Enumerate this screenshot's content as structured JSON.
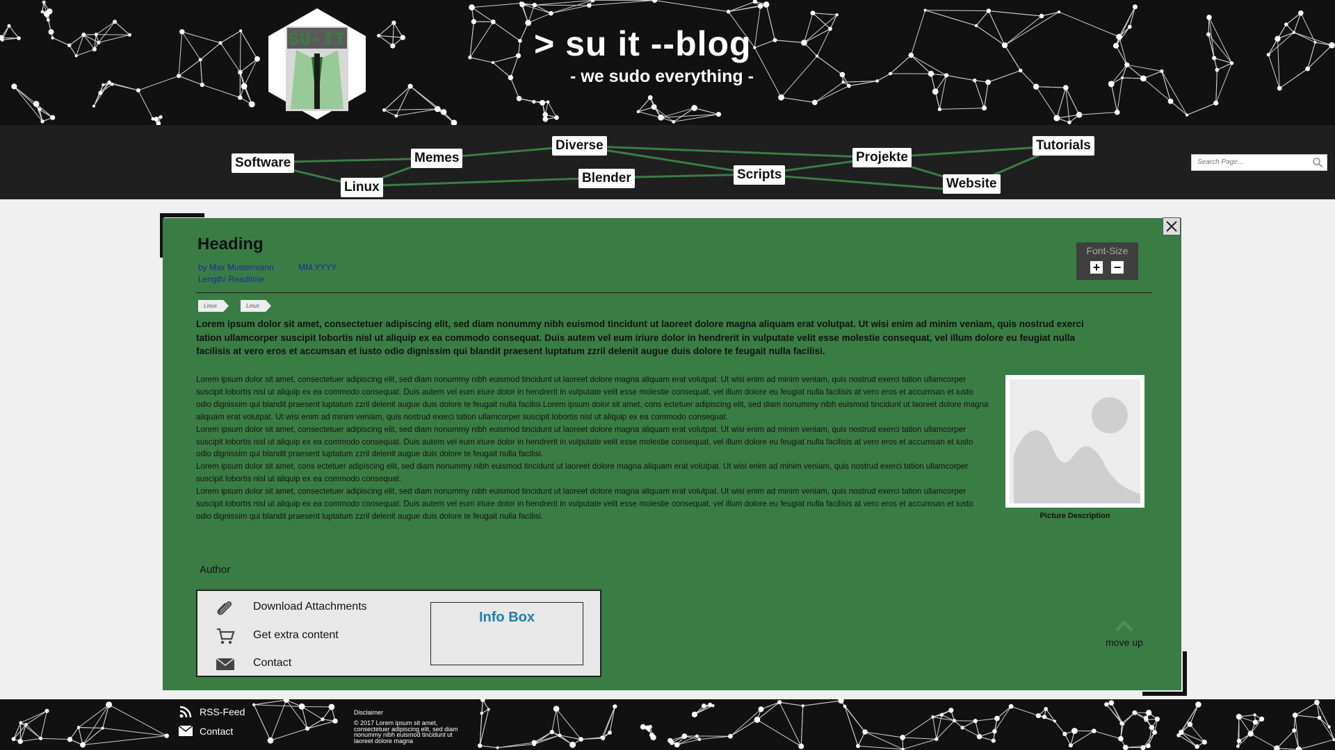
{
  "header": {
    "title": "> su it --blog",
    "subtitle": "- we sudo everything -",
    "logo_text": "SU-IT"
  },
  "nav": {
    "items": [
      {
        "label": "Software"
      },
      {
        "label": "Linux"
      },
      {
        "label": "Memes"
      },
      {
        "label": "Diverse"
      },
      {
        "label": "Blender"
      },
      {
        "label": "Scripts"
      },
      {
        "label": "Projekte"
      },
      {
        "label": "Website"
      },
      {
        "label": "Tutorials"
      }
    ],
    "search_placeholder": "Search Page..."
  },
  "article": {
    "heading": "Heading",
    "author": "by Max Mustermann",
    "date": "MM.YYYY",
    "length": "Length/ Readtime",
    "font_size_label": "Font-Size",
    "font_plus": "+",
    "font_minus": "−",
    "tags": [
      "Linux",
      "Linux"
    ],
    "lead": "Lorem ipsum dolor sit amet, consectetuer adipiscing elit, sed diam nonummy nibh euismod tincidunt ut laoreet dolore magna aliquam erat volutpat. Ut wisi enim ad minim veniam, quis nostrud exerci tation ullamcorper suscipit lobortis nisl ut aliquip ex ea commodo consequat. Duis autem vel eum iriure dolor in hendrerit in vulputate velit esse molestie consequat, vel illum dolore eu feugiat nulla facilisis at vero eros et accumsan et iusto odio dignissim qui blandit praesent luptatum zzril delenit augue duis dolore te feugait nulla facilisi.",
    "paragraphs": [
      "Lorem ipsum dolor sit amet, consectetuer adipiscing elit, sed diam nonummy nibh euismod tincidunt ut laoreet dolore magna aliquam erat volutpat. Ut wisi enim ad minim veniam, quis nostrud exerci tation ullamcorper suscipit lobortis nisl ut aliquip ex ea commodo consequat. Duis autem vel eum iriure dolor in hendrerit in vulputate velit esse molestie consequat, vel illum dolore eu feugiat nulla facilisis at vero eros et accumsan et iusto odio dignissim qui blandit praesent luptatum zzril delenit augue duis dolore te feugait nulla facilisi.Lorem ipsum dolor sit amet, cons ectetuer adipiscing elit, sed diam nonummy nibh euismod tincidunt ut laoreet dolore magna aliquam erat volutpat. Ut wisi enim ad minim veniam, quis nostrud exerci tation ullamcorper suscipit lobortis nisl ut aliquip ex ea commodo consequat.",
      "Lorem ipsum dolor sit amet, consectetuer adipiscing elit, sed diam nonummy nibh euismod tincidunt ut laoreet dolore magna aliquam erat volutpat. Ut wisi enim ad minim veniam, quis nostrud exerci tation ullamcorper suscipit lobortis nisl ut aliquip ex ea commodo consequat. Duis autem vel eum iriure dolor in hendrerit in vulputate velit esse molestie consequat, vel illum dolore eu feugiat nulla facilisis at vero eros et accumsan et iusto odio dignissim qui blandit praesent luptatum zzril delenit augue duis dolore te feugait nulla facilisi.",
      "Lorem ipsum dolor sit amet, cons ectetuer adipiscing elit, sed diam nonummy nibh euismod tincidunt ut laoreet dolore magna aliquam erat volutpat. Ut wisi enim ad minim veniam, quis nostrud exerci tation ullamcorper suscipit lobortis nisl ut aliquip ex ea commodo consequat.",
      "Lorem ipsum dolor sit amet, consectetuer adipiscing elit, sed diam nonummy nibh euismod tincidunt ut laoreet dolore magna aliquam erat volutpat. Ut wisi enim ad minim veniam, quis nostrud exerci tation ullamcorper suscipit lobortis nisl ut aliquip ex ea commodo consequat. Duis autem vel eum iriure dolor in hendrerit in vulputate velit esse molestie consequat, vel illum dolore eu feugiat nulla facilisis at vero eros et accumsan et iusto odio dignissim qui blandit praesent luptatum zzril delenit augue duis dolore te feugait nulla facilisi."
    ],
    "picture_description": "Picture Description",
    "author_label": "Author",
    "actions": {
      "download": "Download Attachments",
      "extra": "Get extra content",
      "contact": "Contact"
    },
    "info_box": "Info Box",
    "move_up": "move up"
  },
  "footer": {
    "rss": "RSS-Feed",
    "contact": "Contact",
    "disclaimer_title": "Disclaimer",
    "disclaimer_text": "© 2017 Lorem ipsum sit amet, consectetuer adipiscing elit, sed diam nonummy nibh euismod tincidunt ut laoreet dolore magna"
  },
  "colors": {
    "header_bg": "#111111",
    "nav_bg": "#1f1f1f",
    "article_bg": "#3a7d44",
    "nav_links": "#3a7d44",
    "info_box_title": "#1d7fb0",
    "meta_text": "#1a2a9a"
  },
  "icons": [
    "search-icon",
    "close-icon",
    "paperclip-icon",
    "cart-icon",
    "mail-icon",
    "rss-icon",
    "chevron-up-icon",
    "image-placeholder-icon"
  ]
}
